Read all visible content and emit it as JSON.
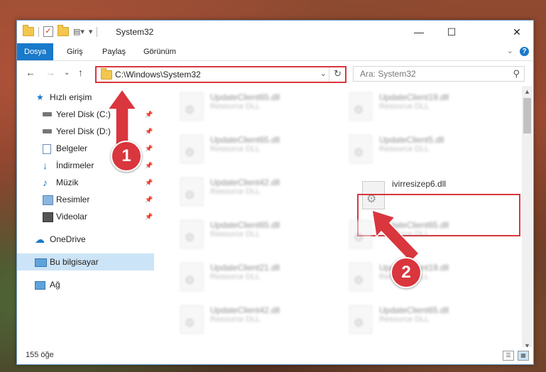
{
  "window": {
    "title": "System32",
    "buttons": {
      "minimize": "—",
      "maximize": "☐",
      "close": "✕"
    }
  },
  "ribbon": {
    "tabs": [
      {
        "label": "Dosya",
        "active": true
      },
      {
        "label": "Giriş"
      },
      {
        "label": "Paylaş"
      },
      {
        "label": "Görünüm"
      }
    ],
    "help": "?"
  },
  "address": {
    "path": "C:\\Windows\\System32"
  },
  "search": {
    "placeholder": "Ara: System32"
  },
  "nav": {
    "quick_access": "Hızlı erişim",
    "items": [
      {
        "label": "Yerel Disk (C:)",
        "icon": "drive-icon",
        "pinned": true
      },
      {
        "label": "Yerel Disk (D:)",
        "icon": "drive-icon",
        "pinned": true
      },
      {
        "label": "Belgeler",
        "icon": "documents-icon",
        "pinned": true
      },
      {
        "label": "İndirmeler",
        "icon": "download-icon",
        "pinned": true
      },
      {
        "label": "Müzik",
        "icon": "music-icon",
        "pinned": true
      },
      {
        "label": "Resimler",
        "icon": "pictures-icon",
        "pinned": true
      },
      {
        "label": "Videolar",
        "icon": "video-icon",
        "pinned": true
      }
    ],
    "onedrive": "OneDrive",
    "this_pc": "Bu bilgisayar",
    "network": "Ağ"
  },
  "files": {
    "col1": [
      {
        "name": "UpdateClient65.dll",
        "desc": "Resource DLL"
      },
      {
        "name": "UpdateClient65.dll",
        "desc": "Resource DLL"
      },
      {
        "name": "UpdateClient42.dll",
        "desc": "Resource DLL"
      },
      {
        "name": "UpdateClient65.dll",
        "desc": "Resource DLL"
      },
      {
        "name": "UpdateClient21.dll",
        "desc": "Resource DLL"
      },
      {
        "name": "UpdateClient42.dll",
        "desc": "Resource DLL"
      }
    ],
    "col2": [
      {
        "name": "UpdateClient19.dll",
        "desc": "Resource DLL"
      },
      {
        "name": "UpdateClient5.dll",
        "desc": "Resource DLL"
      },
      {
        "name": "ivirresizep6.dll",
        "desc": "",
        "highlighted": true
      },
      {
        "name": "UpdateClient65.dll",
        "desc": "Resource DLL"
      },
      {
        "name": "UpdateClient19.dll",
        "desc": "Resource DLL"
      },
      {
        "name": "UpdateClient65.dll",
        "desc": "Resource DLL"
      }
    ]
  },
  "status": {
    "count": "155 öğe"
  },
  "annotations": {
    "step1": "1",
    "step2": "2",
    "color": "#d9363e"
  }
}
